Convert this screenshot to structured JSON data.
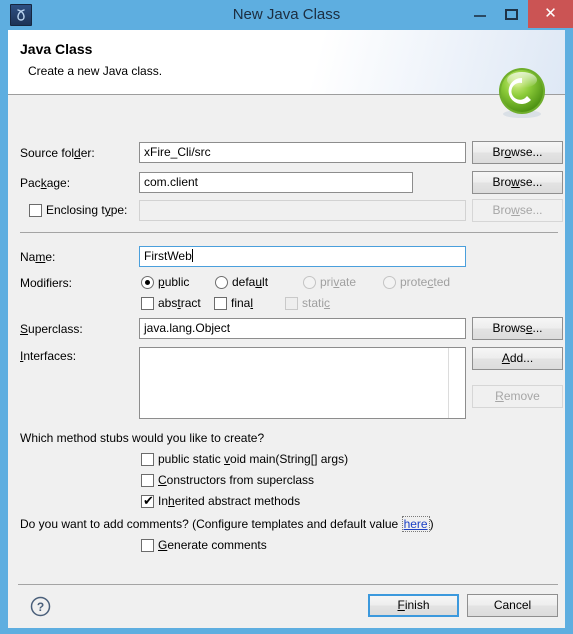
{
  "window": {
    "title": "New Java Class",
    "app_icon": "java-class-icon",
    "controls": {
      "minimize": "minimize-icon",
      "maximize": "maximize-icon",
      "close": "✕"
    },
    "frame_color": "#5eaee0",
    "close_color": "#cb5454"
  },
  "header": {
    "title": "Java Class",
    "description": "Create a new Java class.",
    "icon": "green-class-badge-icon"
  },
  "form": {
    "source_folder": {
      "label": "Source folder:",
      "label_mnemonic": "d",
      "value": "xFire_Cli/src",
      "browse": "Browse...",
      "browse_mnemonic": "o"
    },
    "package": {
      "label": "Package:",
      "label_mnemonic": "k",
      "value": "com.client",
      "browse": "Browse...",
      "browse_mnemonic": "w"
    },
    "enclosing_type": {
      "label": "Enclosing type:",
      "label_mnemonic": "y",
      "checked": false,
      "value": "",
      "enabled": false,
      "browse": "Browse...",
      "browse_mnemonic": "w"
    },
    "name": {
      "label": "Name:",
      "label_mnemonic": "m",
      "value": "FirstWeb",
      "focused": true
    },
    "modifiers": {
      "label": "Modifiers:",
      "radios": [
        {
          "label": "public",
          "mnemonic": "p",
          "selected": true,
          "enabled": true
        },
        {
          "label": "default",
          "mnemonic": "u",
          "selected": false,
          "enabled": true
        },
        {
          "label": "private",
          "mnemonic": "v",
          "selected": false,
          "enabled": false
        },
        {
          "label": "protected",
          "mnemonic": "c",
          "selected": false,
          "enabled": false
        }
      ],
      "checkboxes": [
        {
          "label": "abstract",
          "mnemonic": "t",
          "checked": false,
          "enabled": true
        },
        {
          "label": "final",
          "mnemonic": "l",
          "checked": false,
          "enabled": true
        },
        {
          "label": "static",
          "mnemonic": "c",
          "checked": false,
          "enabled": false
        }
      ]
    },
    "superclass": {
      "label": "Superclass:",
      "label_mnemonic": "S",
      "value": "java.lang.Object",
      "browse": "Browse...",
      "browse_mnemonic": "e"
    },
    "interfaces": {
      "label": "Interfaces:",
      "label_mnemonic": "I",
      "items": [],
      "add": "Add...",
      "add_mnemonic": "A",
      "remove": "Remove",
      "remove_mnemonic": "R",
      "remove_enabled": false
    }
  },
  "stubs": {
    "question": "Which method stubs would you like to create?",
    "options": [
      {
        "label": "public static void main(String[] args)",
        "checked": false
      },
      {
        "label": "Constructors from superclass",
        "checked": false
      },
      {
        "label": "Inherited abstract methods",
        "checked": true
      }
    ]
  },
  "comments": {
    "question_prefix": "Do you want to add comments? (Configure templates and default value ",
    "link": "here",
    "question_suffix": ")",
    "checkbox": {
      "label": "Generate comments",
      "mnemonic": "G",
      "checked": false
    }
  },
  "footer": {
    "help": "help-icon",
    "finish": "Finish",
    "finish_mnemonic": "F",
    "cancel": "Cancel",
    "default_button": "Finish"
  }
}
